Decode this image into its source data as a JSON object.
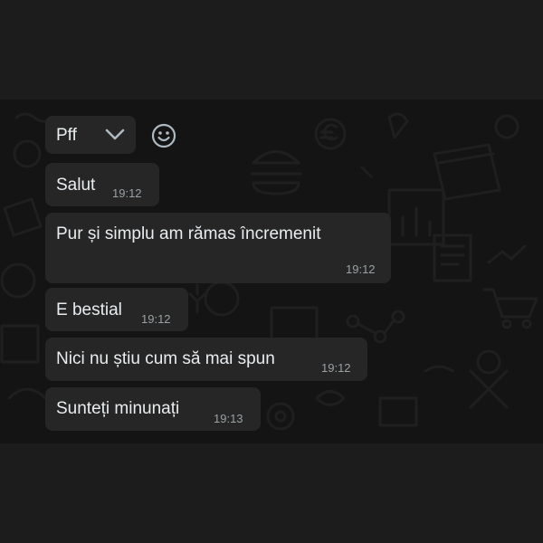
{
  "messages": [
    {
      "text": "Pff",
      "time": ""
    },
    {
      "text": "Salut",
      "time": "19:12"
    },
    {
      "text": "Pur și simplu am rămas încremenit",
      "time": "19:12"
    },
    {
      "text": "E bestial",
      "time": "19:12"
    },
    {
      "text": "Nici nu știu cum să mai spun",
      "time": "19:12"
    },
    {
      "text": "Sunteți minunați",
      "time": "19:13"
    }
  ],
  "icons": {
    "menu": "chevron-down-icon",
    "react": "emoji-icon"
  },
  "colors": {
    "background": "#1c1c1c",
    "chat_background": "#141414",
    "bubble": "#262626",
    "text": "#e9edef",
    "timestamp": "#9aa0a3"
  }
}
